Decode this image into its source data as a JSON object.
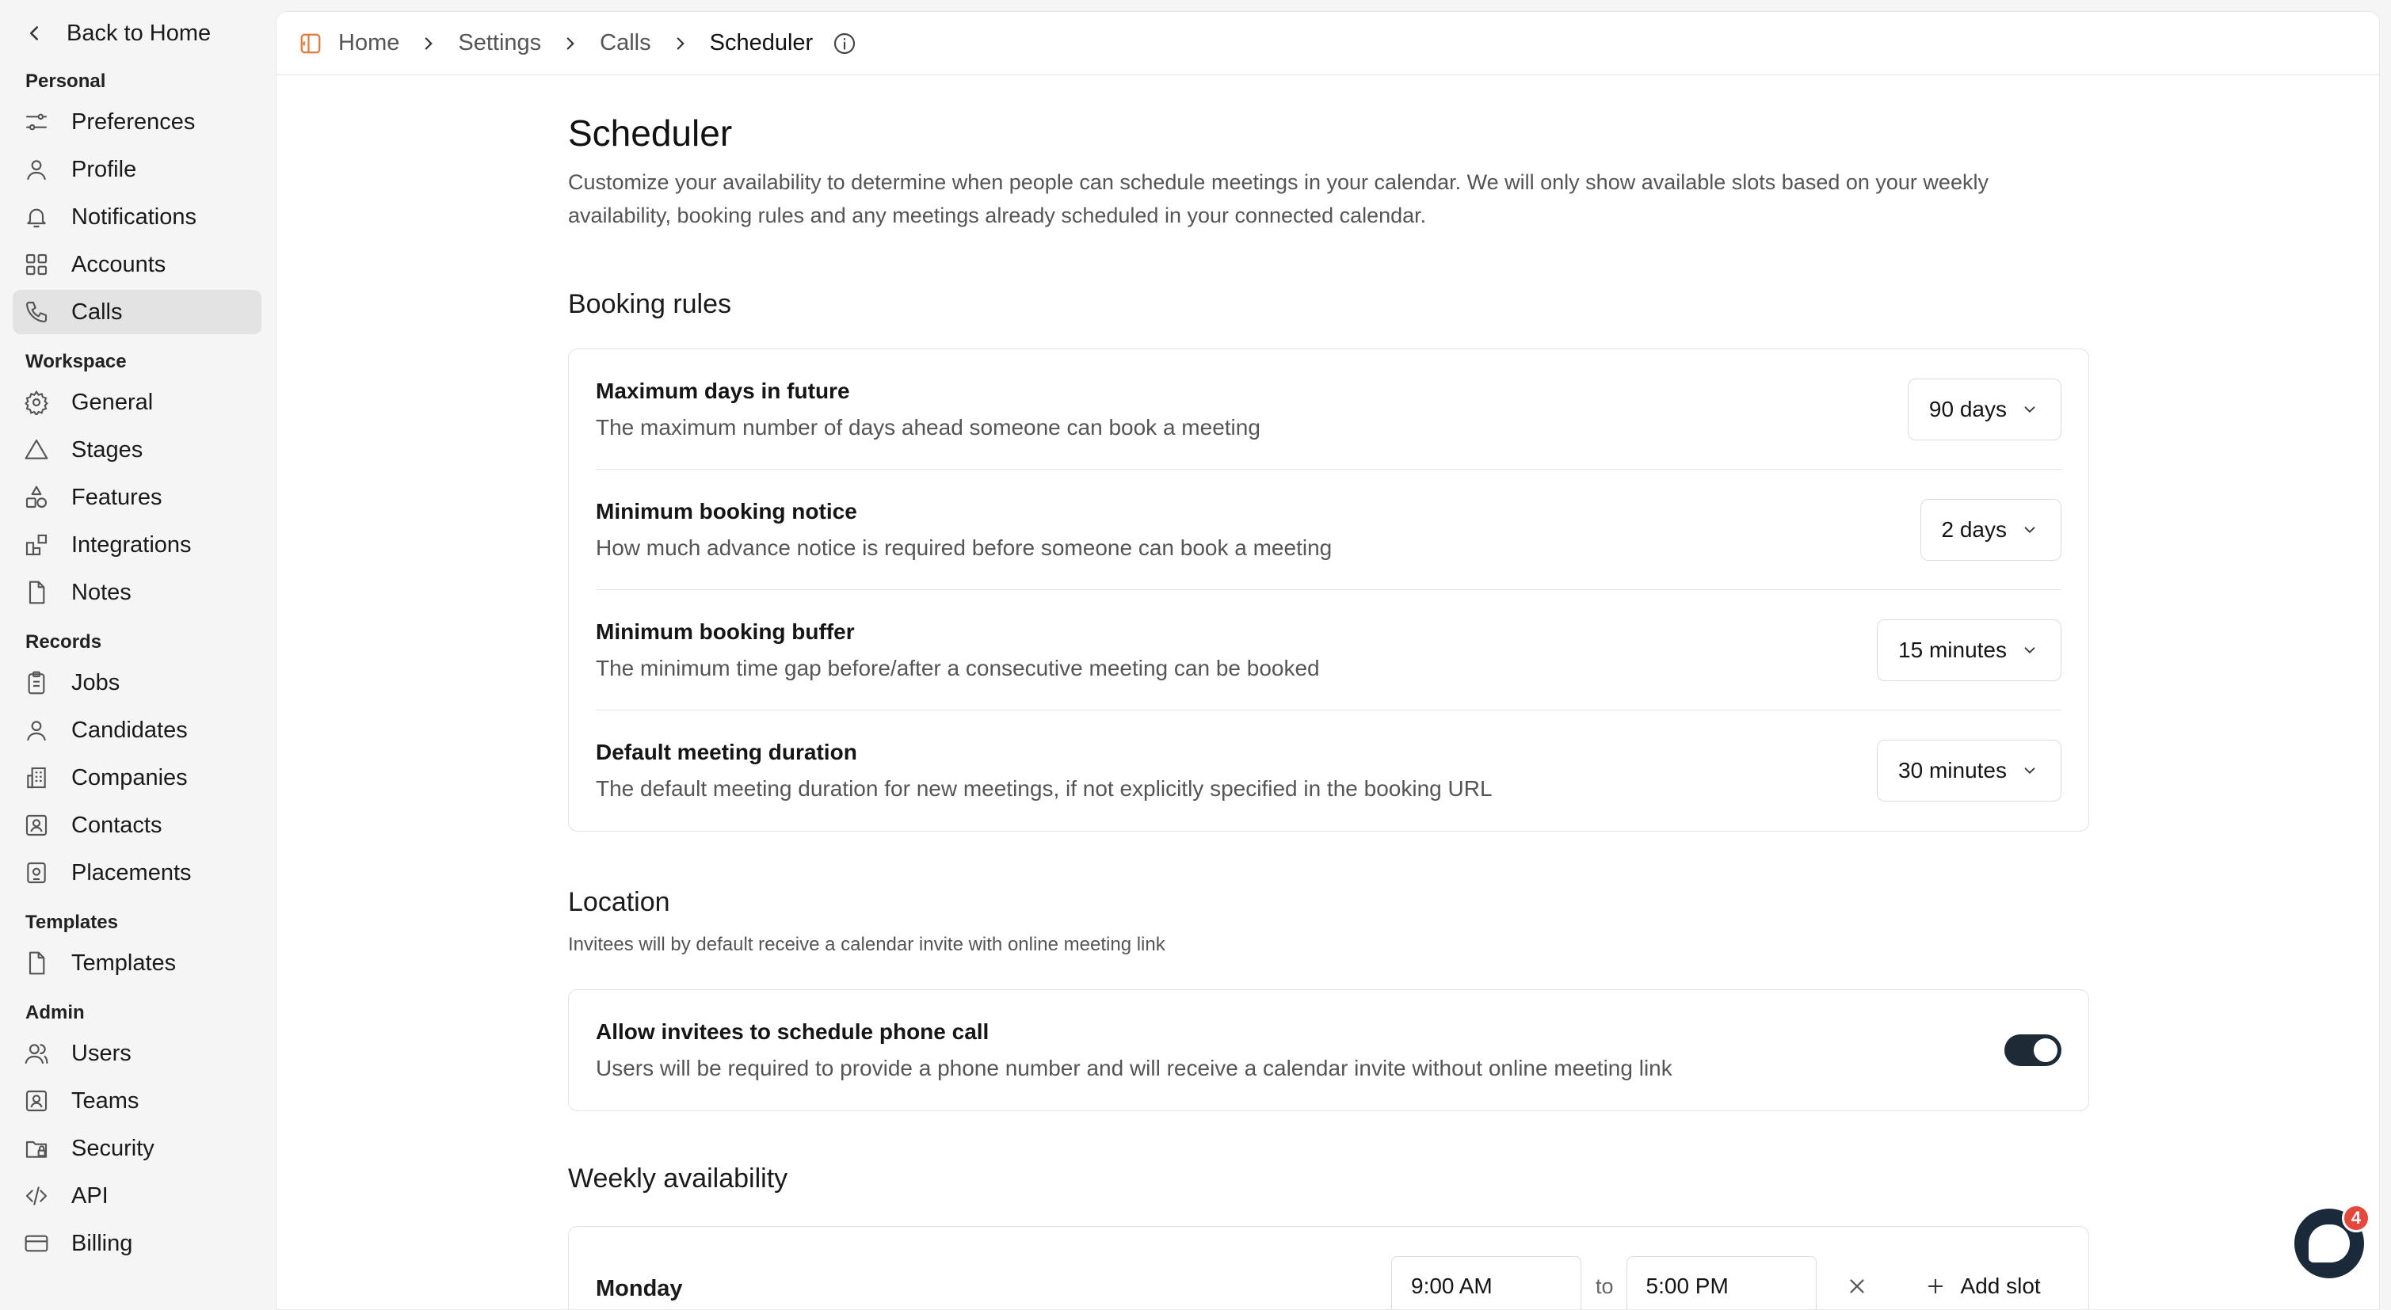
{
  "sidebar": {
    "back_label": "Back to Home",
    "sections": [
      {
        "label": "Personal",
        "items": [
          {
            "label": "Preferences",
            "icon": "sliders-icon"
          },
          {
            "label": "Profile",
            "icon": "user-icon"
          },
          {
            "label": "Notifications",
            "icon": "bell-icon"
          },
          {
            "label": "Accounts",
            "icon": "grid-icon"
          },
          {
            "label": "Calls",
            "icon": "phone-icon",
            "active": true
          }
        ]
      },
      {
        "label": "Workspace",
        "items": [
          {
            "label": "General",
            "icon": "gear-icon"
          },
          {
            "label": "Stages",
            "icon": "triangle-icon"
          },
          {
            "label": "Features",
            "icon": "shapes-icon"
          },
          {
            "label": "Integrations",
            "icon": "blocks-icon"
          },
          {
            "label": "Notes",
            "icon": "file-icon"
          }
        ]
      },
      {
        "label": "Records",
        "items": [
          {
            "label": "Jobs",
            "icon": "clipboard-icon"
          },
          {
            "label": "Candidates",
            "icon": "user-icon"
          },
          {
            "label": "Companies",
            "icon": "building-icon"
          },
          {
            "label": "Contacts",
            "icon": "contact-icon"
          },
          {
            "label": "Placements",
            "icon": "badge-icon"
          }
        ]
      },
      {
        "label": "Templates",
        "items": [
          {
            "label": "Templates",
            "icon": "file-icon"
          }
        ]
      },
      {
        "label": "Admin",
        "items": [
          {
            "label": "Users",
            "icon": "users-icon"
          },
          {
            "label": "Teams",
            "icon": "contact-icon"
          },
          {
            "label": "Security",
            "icon": "folder-lock-icon"
          },
          {
            "label": "API",
            "icon": "code-icon"
          },
          {
            "label": "Billing",
            "icon": "card-icon"
          }
        ]
      }
    ]
  },
  "breadcrumb": [
    "Home",
    "Settings",
    "Calls",
    "Scheduler"
  ],
  "page": {
    "title": "Scheduler",
    "description": "Customize your availability to determine when people can schedule meetings in your calendar. We will only show available slots based on your weekly availability, booking rules and any meetings already scheduled in your connected calendar."
  },
  "booking_rules": {
    "title": "Booking rules",
    "rows": [
      {
        "title": "Maximum days in future",
        "desc": "The maximum number of days ahead someone can book a meeting",
        "value": "90 days"
      },
      {
        "title": "Minimum booking notice",
        "desc": "How much advance notice is required before someone can book a meeting",
        "value": "2 days"
      },
      {
        "title": "Minimum booking buffer",
        "desc": "The minimum time gap before/after a consecutive meeting can be booked",
        "value": "15 minutes"
      },
      {
        "title": "Default meeting duration",
        "desc": "The default meeting duration for new meetings, if not explicitly specified in the booking URL",
        "value": "30 minutes"
      }
    ]
  },
  "location": {
    "title": "Location",
    "subtitle": "Invitees will by default receive a calendar invite with online meeting link",
    "phone_title": "Allow invitees to schedule phone call",
    "phone_desc": "Users will be required to provide a phone number and will receive a calendar invite without online meeting link",
    "phone_enabled": true
  },
  "weekly": {
    "title": "Weekly availability",
    "day": "Monday",
    "start": "9:00 AM",
    "to_label": "to",
    "end": "5:00 PM",
    "add_slot_label": "Add slot"
  },
  "chat": {
    "badge": "4"
  }
}
